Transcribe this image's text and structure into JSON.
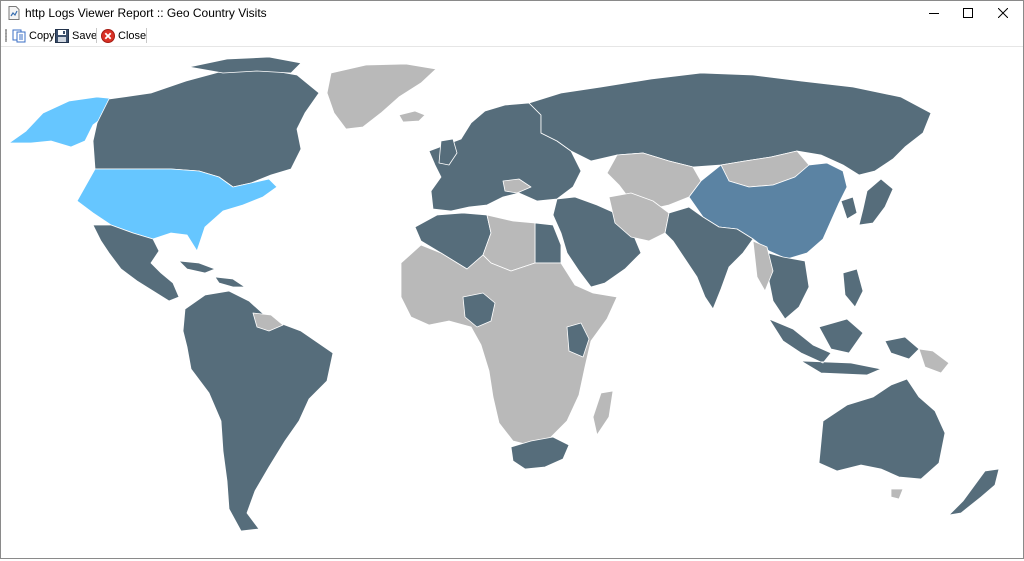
{
  "window": {
    "title": "http Logs Viewer Report :: Geo Country Visits",
    "minimize_icon": "minimize-icon",
    "maximize_icon": "maximize-icon",
    "close_icon": "close-icon"
  },
  "toolbar": {
    "copy_label": "Copy",
    "save_label": "Save",
    "close_label": "Close"
  },
  "map": {
    "colors": {
      "no_visits": "#b9b9b9",
      "visits": "#566d7b",
      "medium_visits": "#5b83a3",
      "high_visits": "#66c6ff",
      "border": "#ffffff"
    },
    "highlighted": [
      {
        "country": "United States",
        "level": "high_visits"
      },
      {
        "country": "Alaska",
        "level": "high_visits"
      },
      {
        "country": "China",
        "level": "medium_visits"
      }
    ]
  }
}
